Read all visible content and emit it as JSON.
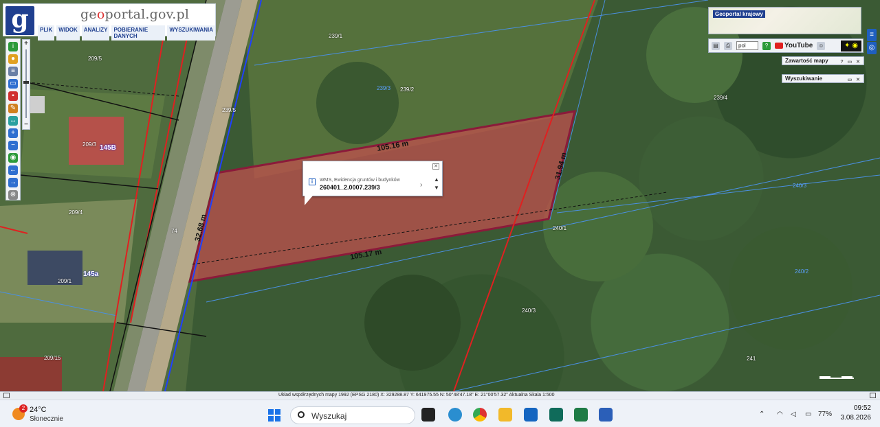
{
  "header": {
    "logo_letter": "g",
    "title_pre": "ge",
    "title_accent": "o",
    "title_post": "portal.gov.pl",
    "menu": [
      "PLIK",
      "WIDOK",
      "ANALIZY",
      "POBIERANIE DANYCH",
      "WYSZUKIWANIA"
    ]
  },
  "zoom": {
    "plus": "+",
    "minus": "−"
  },
  "overview": {
    "title": "Geoportal krajowy"
  },
  "controls": {
    "language": "pol",
    "youtube_label": "YouTube"
  },
  "panels": {
    "map_contents": "Zawartość mapy",
    "search": "Wyszukiwanie"
  },
  "parcels": {
    "labels": [
      "239/1",
      "239/2",
      "239/3",
      "239/4",
      "209/5",
      "209/3",
      "209/4",
      "209/1",
      "209/15",
      "239/5",
      "240/1",
      "240/2",
      "240/3",
      "240/3",
      "241",
      "74"
    ],
    "addresses": [
      "145B",
      "145a"
    ]
  },
  "measurements": {
    "top": "105.16 m",
    "bottom": "105.17 m",
    "left": "32.68 m",
    "right": "31.94 m"
  },
  "popup": {
    "source": "WMS, Ewidencja gruntów i budynków",
    "parcel_id": "260401_2.0007.239/3",
    "close": "✕",
    "next": "›",
    "up": "▲",
    "down": "▼"
  },
  "statusbar": {
    "text": "Układ współrzędnych mapy 1992 (EPSG 2180)   X: 329288.87 Y: 641975.55   N: 50°48'47.18\" E: 21°00'57.32\"   Aktualna Skala 1:500"
  },
  "taskbar": {
    "weather_badge": "2",
    "weather_temp": "24°C",
    "weather_desc": "Słonecznie",
    "search_placeholder": "Wyszukaj",
    "battery": "77%",
    "time": "09:52",
    "date": "3.08.2026"
  },
  "colors": {
    "brand": "#1f3f8f",
    "parcel_fill": "#c0504d",
    "parcel_border": "#8b1a3a",
    "boundary_red": "#e02020",
    "boundary_blue": "#4a90e2"
  }
}
